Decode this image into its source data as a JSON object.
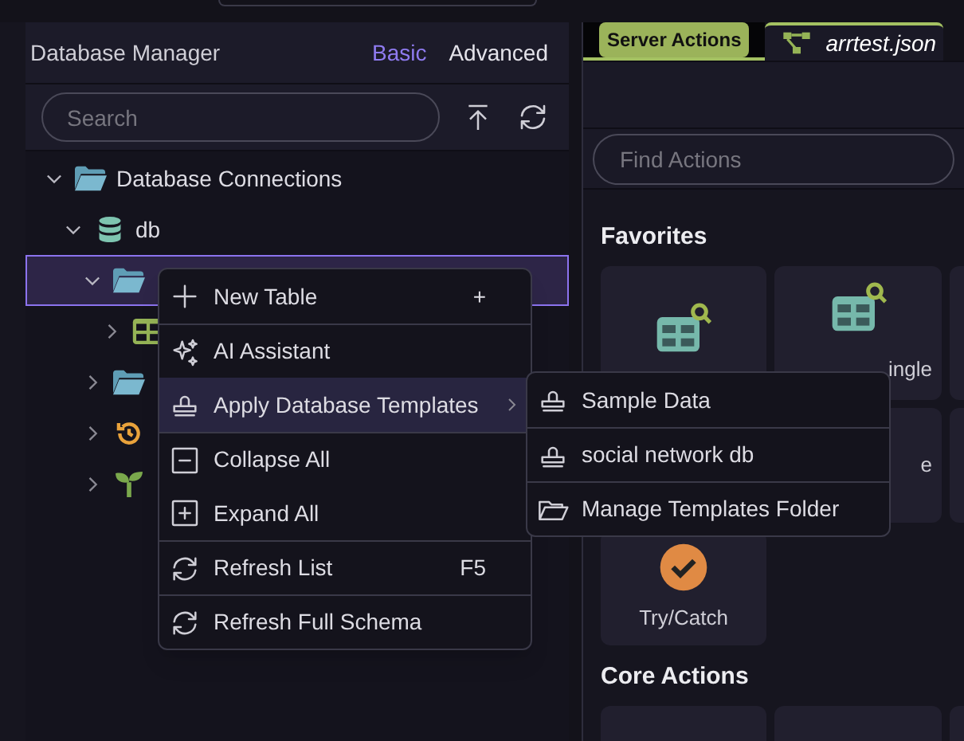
{
  "left_panel": {
    "title": "Database Manager",
    "modes": [
      {
        "label": "Basic",
        "selected": true
      },
      {
        "label": "Advanced",
        "selected": false
      }
    ],
    "search": {
      "placeholder": "Search"
    },
    "tree": [
      {
        "label": "Database Connections",
        "kind": "folder",
        "expanded": true,
        "selected": false,
        "children": [
          {
            "label": "db",
            "kind": "database",
            "expanded": true,
            "selected": false,
            "children": [
              {
                "kind": "folder",
                "expanded": true,
                "selected": true,
                "children": [
                  {
                    "kind": "table",
                    "expanded": false,
                    "selected": false
                  }
                ]
              },
              {
                "kind": "folder",
                "expanded": false,
                "selected": false
              },
              {
                "kind": "history",
                "expanded": false,
                "selected": false
              },
              {
                "kind": "sprout",
                "expanded": false,
                "selected": false
              }
            ]
          }
        ]
      }
    ]
  },
  "context_menu": {
    "items": [
      {
        "kind": "plus",
        "label": "New Table",
        "shortcut": "+",
        "highlighted": false,
        "has_submenu": false
      },
      {
        "kind": "sparkles",
        "label": "AI Assistant",
        "highlighted": false,
        "has_submenu": false
      },
      {
        "kind": "stamp",
        "label": "Apply Database Templates",
        "highlighted": true,
        "has_submenu": true
      },
      {
        "kind": "minus-box",
        "label": "Collapse All",
        "highlighted": false,
        "has_submenu": false
      },
      {
        "kind": "plus-box",
        "label": "Expand All",
        "highlighted": false,
        "has_submenu": false
      },
      {
        "kind": "refresh",
        "label": "Refresh List",
        "shortcut": "F5",
        "highlighted": false,
        "has_submenu": false
      },
      {
        "kind": "refresh",
        "label": "Refresh Full Schema",
        "highlighted": false,
        "has_submenu": false
      }
    ],
    "submenu": [
      {
        "kind": "stamp",
        "label": "Sample Data"
      },
      {
        "kind": "stamp",
        "label": "social network db"
      },
      {
        "kind": "folder",
        "label": "Manage Templates Folder"
      }
    ]
  },
  "right_panel": {
    "tabs": [
      {
        "label": "Server Actions",
        "kind": "badge",
        "selected": false
      },
      {
        "label": "arrtest.json",
        "kind": "file",
        "selected": true
      }
    ],
    "search": {
      "placeholder": "Find Actions"
    },
    "sections": [
      {
        "title": "Favorites",
        "cards": [
          {
            "kind": "table-search"
          },
          {
            "kind": "table-search",
            "label": "ingle"
          },
          {
            "kind": "blank"
          },
          {
            "kind": "blank"
          },
          {
            "kind": "blank",
            "label": "e"
          },
          {
            "kind": "blank"
          },
          {
            "kind": "check",
            "label": "Try/Catch"
          }
        ]
      },
      {
        "title": "Core Actions",
        "cards": [
          {
            "kind": "blank"
          },
          {
            "kind": "blank"
          },
          {
            "kind": "blank"
          }
        ]
      }
    ]
  }
}
